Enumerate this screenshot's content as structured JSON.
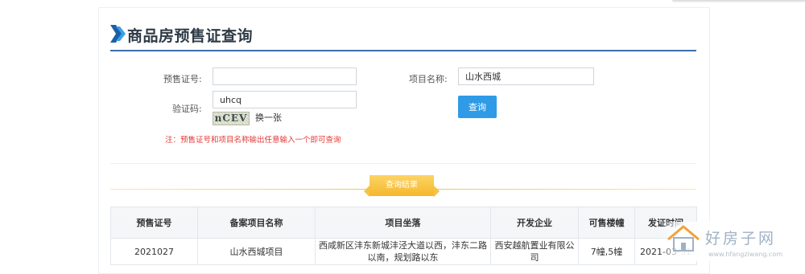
{
  "page": {
    "title": "商品房预售证查询"
  },
  "form": {
    "license_no_label": "预售证号:",
    "license_no_value": "",
    "project_name_label": "项目名称:",
    "project_name_value": "山水西城",
    "captcha_label": "验证码:",
    "captcha_value": "uhcq",
    "captcha_image_text": "nCEV",
    "refresh_label": "换一张",
    "query_button": "查询",
    "note": "注：预售证号和项目名称输出任意输入一个即可查询"
  },
  "results": {
    "section_label": "查询结果",
    "columns": [
      "预售证号",
      "备案项目名称",
      "项目坐落",
      "开发企业",
      "可售楼幢",
      "发证时间"
    ],
    "rows": [
      {
        "license_no": "2021027",
        "project_name": "山水西城项目",
        "location": "西咸新区沣东新城沣泾大道以西，沣东二路以南，规划路以东",
        "developer": "西安越航置业有限公司",
        "buildings": "7幢,5幢",
        "issue_date": "2021-03-31"
      }
    ]
  },
  "watermark": {
    "text": "好房子网",
    "url": "www.hfangziwang.com"
  },
  "colors": {
    "accent": "#3d6fa6",
    "button": "#2f9be6",
    "note": "#e53935",
    "result_tag": "#f5b72c"
  },
  "icons": {
    "header": "double-chevron-right-icon",
    "watermark": "house-logo-icon"
  }
}
